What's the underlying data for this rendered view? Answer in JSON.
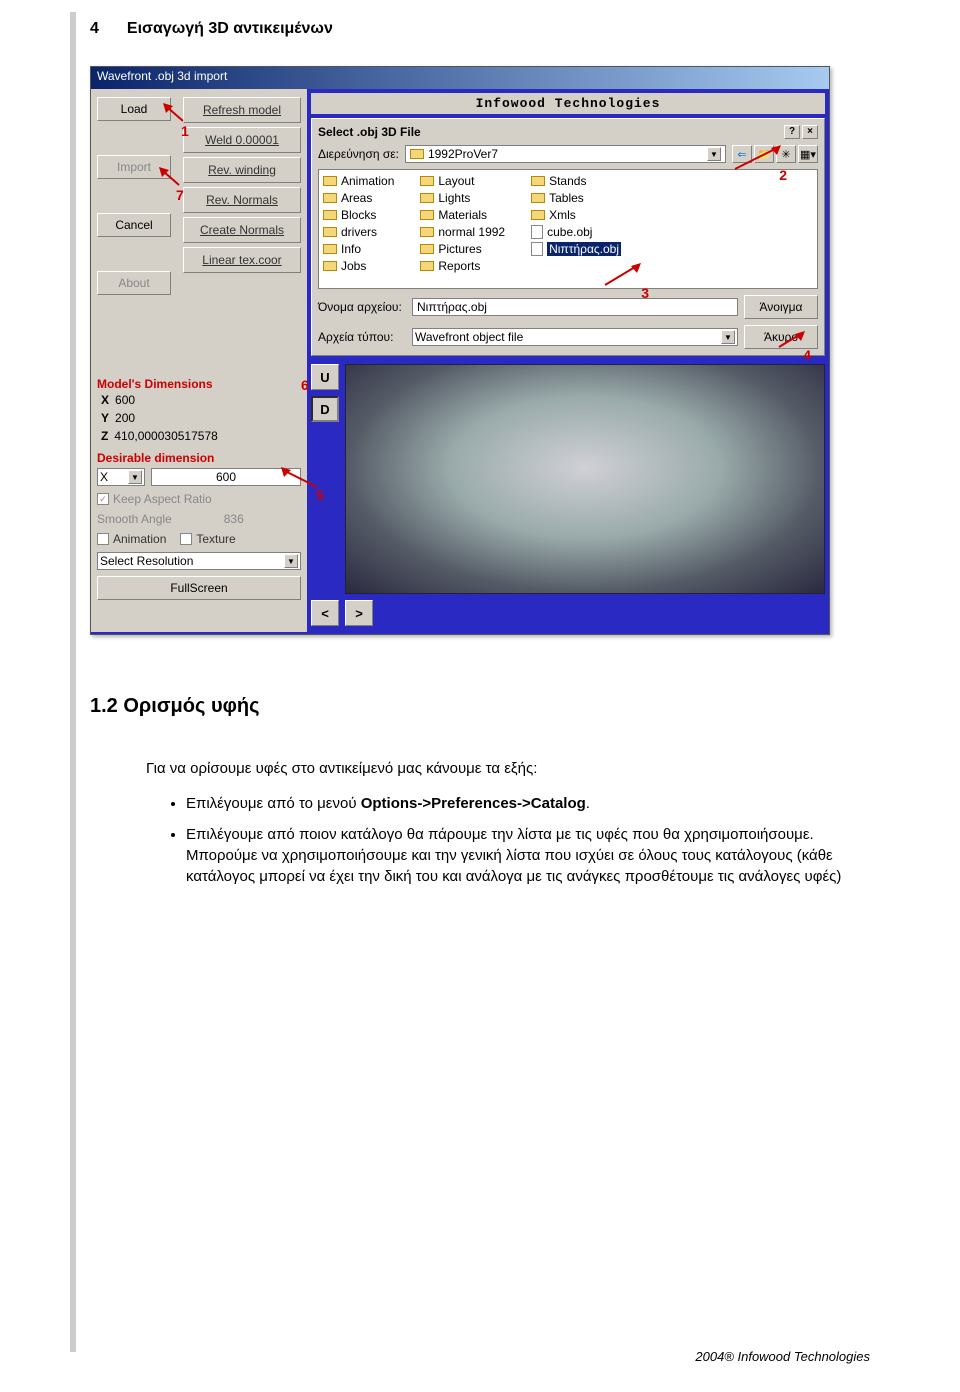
{
  "page_number": "4",
  "page_title": "Εισαγωγή 3D αντικειμένων",
  "app": {
    "window_title": "Wavefront .obj 3d import",
    "brand": "Infowood Technologies",
    "side_buttons": {
      "load": "Load",
      "import": "Import",
      "cancel": "Cancel",
      "about": "About"
    },
    "mid_buttons": {
      "refresh": "Refresh model",
      "weld": "Weld 0.00001",
      "revwind": "Rev. winding",
      "revnorm": "Rev. Normals",
      "create": "Create Normals",
      "linear": "Linear tex.coor"
    },
    "model_dim_label": "Model's Dimensions",
    "dims": {
      "x_lbl": "X",
      "x": "600",
      "y_lbl": "Y",
      "y": "200",
      "z_lbl": "Z",
      "z": "410,000030517578"
    },
    "desirable_label": "Desirable dimension",
    "axis_sel": "X",
    "axis_val": "600",
    "keep_aspect": "Keep Aspect Ratio",
    "smooth_label": "Smooth Angle",
    "smooth_val": "836",
    "animation_chk": "Animation",
    "texture_chk": "Texture",
    "resolution_sel": "Select Resolution",
    "fullscreen": "FullScreen",
    "preview_u": "U",
    "preview_d": "D",
    "preview_lt": "<",
    "preview_gt": ">"
  },
  "file_dialog": {
    "title": "Select .obj 3D File",
    "look_in_label": "Διερεύνηση σε:",
    "folder": "1992ProVer7",
    "cols": [
      [
        "Animation",
        "Areas",
        "Blocks",
        "drivers",
        "Info",
        "Jobs"
      ],
      [
        "Layout",
        "Lights",
        "Materials",
        "normal 1992",
        "Pictures",
        "Reports"
      ],
      [
        "Stands",
        "Tables",
        "Xmls"
      ]
    ],
    "files": [
      "cube.obj",
      "Νιπτήρας.obj"
    ],
    "filename_label": "Όνομα αρχείου:",
    "filename_value": "Νιπτήρας.obj",
    "type_label": "Αρχεία τύπου:",
    "type_value": "Wavefront object file",
    "open_btn": "Άνοιγμα",
    "cancel_btn": "Άκυρο"
  },
  "markers": {
    "m1": "1",
    "m2": "2",
    "m3": "3",
    "m4": "4",
    "m5": "5",
    "m6": "6",
    "m7": "7"
  },
  "doc": {
    "heading": "1.2 Ορισμός υφής",
    "intro": "Για να ορίσουμε υφές στο αντικείμενό μας κάνουμε τα εξής:",
    "bullet1_a": "Επιλέγουμε από το μενού ",
    "bullet1_b": "Options->Preferences->Catalog",
    "bullet1_c": ".",
    "bullet2": "Επιλέγουμε από ποιον κατάλογο θα πάρουμε την λίστα με τις υφές που θα χρησιμοποιήσουμε. Μπορούμε να χρησιμοποιήσουμε και την γενική λίστα που ισχύει σε όλους τους κατάλογους (κάθε κατάλογος μπορεί να έχει την δική του και ανάλογα με τις ανάγκες προσθέτουμε τις ανάλογες υφές)"
  },
  "footer": "2004® Infowood Technologies"
}
